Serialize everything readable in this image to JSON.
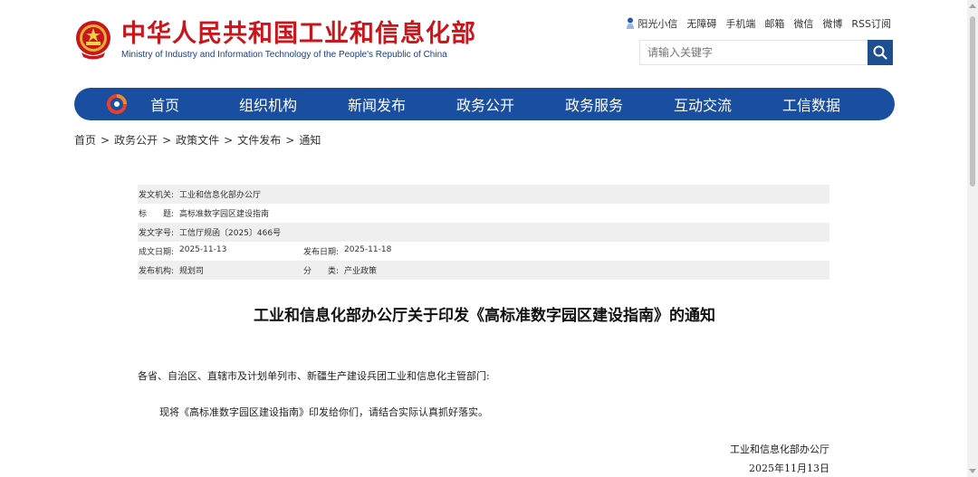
{
  "header": {
    "title_cn": "中华人民共和国工业和信息化部",
    "title_en": "Ministry of Industry and Information Technology of the People's Republic of China",
    "toplinks": [
      "阳光小信",
      "无障碍",
      "手机端",
      "邮箱",
      "微信",
      "微博",
      "RSS订阅"
    ],
    "search_placeholder": "请输入关键字"
  },
  "nav": {
    "items": [
      "首页",
      "组织机构",
      "新闻发布",
      "政务公开",
      "政务服务",
      "互动交流",
      "工信数据"
    ]
  },
  "breadcrumb": [
    "首页",
    "政务公开",
    "政策文件",
    "文件发布",
    "通知"
  ],
  "breadcrumb_sep": ">",
  "info": {
    "issuer_label": "发文机关:",
    "issuer": "工业和信息化部办公厅",
    "title_label": "标　　题:",
    "title": "高标准数字园区建设指南",
    "docno_label": "发文字号:",
    "docno": "工信厅规函〔2025〕466号",
    "created_label": "成文日期:",
    "created": "2025-11-13",
    "published_label": "发布日期:",
    "published": "2025-11-18",
    "org_label": "发布机构:",
    "org": "规划司",
    "category_label": "分　　类:",
    "category": "产业政策"
  },
  "article": {
    "title": "工业和信息化部办公厅关于印发《高标准数字园区建设指南》的通知",
    "addressee": "各省、自治区、直辖市及计划单列市、新疆生产建设兵团工业和信息化主管部门:",
    "body": "现将《高标准数字园区建设指南》印发给你们，请结合实际认真抓好落实。",
    "signature": "工业和信息化部办公厅",
    "date": "2025年11月13日"
  },
  "colors": {
    "nav_bg": "#1a4ea1",
    "title_red": "#c8161d",
    "en_blue": "#1a3d8f"
  }
}
